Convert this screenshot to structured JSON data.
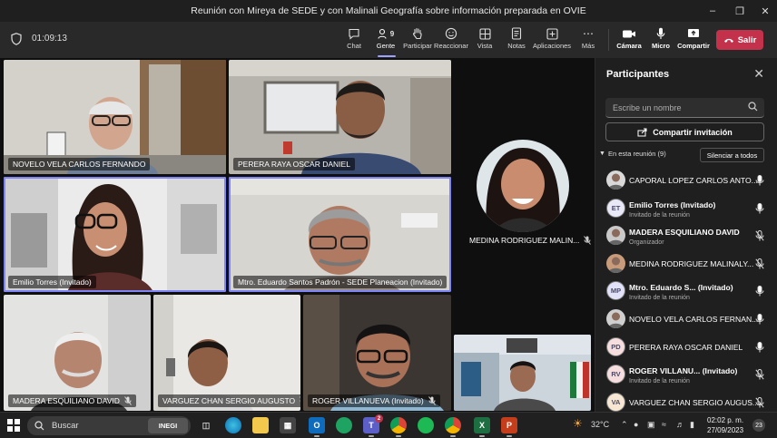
{
  "window": {
    "title": "Reunión con Mireya de SEDE y con Malinali Geografía sobre información preparada en OVIE"
  },
  "toolbar": {
    "timer": "01:09:13",
    "people_count": "9",
    "buttons": [
      {
        "name": "chat",
        "label": "Chat"
      },
      {
        "name": "people",
        "label": "Gente"
      },
      {
        "name": "raise",
        "label": "Participar"
      },
      {
        "name": "react",
        "label": "Reaccionar"
      },
      {
        "name": "view",
        "label": "Vista"
      },
      {
        "name": "notes",
        "label": "Notas"
      },
      {
        "name": "apps",
        "label": "Aplicaciones"
      },
      {
        "name": "more",
        "label": "Más"
      },
      {
        "name": "camera",
        "label": "Cámara"
      },
      {
        "name": "mic",
        "label": "Micro"
      },
      {
        "name": "share",
        "label": "Compartir"
      }
    ],
    "leave_label": "Salir"
  },
  "tiles": [
    {
      "name": "NOVELO VELA CARLOS FERNANDO",
      "muted": false
    },
    {
      "name": "PERERA RAYA OSCAR DANIEL",
      "muted": false
    },
    {
      "name": "Emilio Torres (Invitado)",
      "muted": false
    },
    {
      "name": "Mtro. Eduardo Santos Padrón - SEDE Planeacion (Invitado)",
      "muted": false
    },
    {
      "name": "MEDINA RODRIGUEZ MALIN...",
      "muted": true
    },
    {
      "name": "MADERA ESQUILIANO DAVID",
      "muted": true
    },
    {
      "name": "VARGUEZ CHAN SERGIO AUGUSTO",
      "muted": true
    },
    {
      "name": "ROGER VILLANUEVA (Invitado)",
      "muted": true
    }
  ],
  "panel": {
    "title": "Participantes",
    "search_placeholder": "Escribe un nombre",
    "invite_label": "Compartir invitación",
    "section_label": "En esta reunión (9)",
    "mute_all_label": "Silenciar a todos",
    "participants": [
      {
        "name": "CAPORAL LOPEZ CARLOS ANTO...",
        "sub": "",
        "initials": "",
        "avatar_color": "#d9d9d9",
        "muted": false
      },
      {
        "name": "Emilio Torres (Invitado)",
        "sub": "Invitado de la reunión",
        "initials": "ET",
        "avatar_color": "#e8e8f7",
        "muted": false
      },
      {
        "name": "MADERA ESQUILIANO DAVID",
        "sub": "Organizador",
        "initials": "",
        "avatar_color": "#c9c9c9",
        "muted": true
      },
      {
        "name": "MEDINA RODRIGUEZ MALINALY...",
        "sub": "",
        "initials": "",
        "avatar_color": "#c89b7b",
        "muted": true
      },
      {
        "name": "Mtro. Eduardo S... (Invitado)",
        "sub": "Invitado de la reunión",
        "initials": "MP",
        "avatar_color": "#e1e1f7",
        "muted": false
      },
      {
        "name": "NOVELO VELA CARLOS FERNAN...",
        "sub": "",
        "initials": "",
        "avatar_color": "#cfcfcf",
        "muted": false
      },
      {
        "name": "PERERA RAYA OSCAR DANIEL",
        "sub": "",
        "initials": "PD",
        "avatar_color": "#f6dede",
        "muted": false
      },
      {
        "name": "ROGER VILLANU... (Invitado)",
        "sub": "Invitado de la reunión",
        "initials": "RV",
        "avatar_color": "#f6dede",
        "muted": true
      },
      {
        "name": "VARGUEZ CHAN SERGIO AUGUS...",
        "sub": "",
        "initials": "VA",
        "avatar_color": "#f7e6d2",
        "muted": true
      }
    ]
  },
  "taskbar": {
    "search_label": "Buscar",
    "inegi_label": "INEGI",
    "teams_badge": "2",
    "weather": "32°C",
    "time": "02:02 p. m.",
    "date": "27/09/2023",
    "notifications": "23"
  }
}
